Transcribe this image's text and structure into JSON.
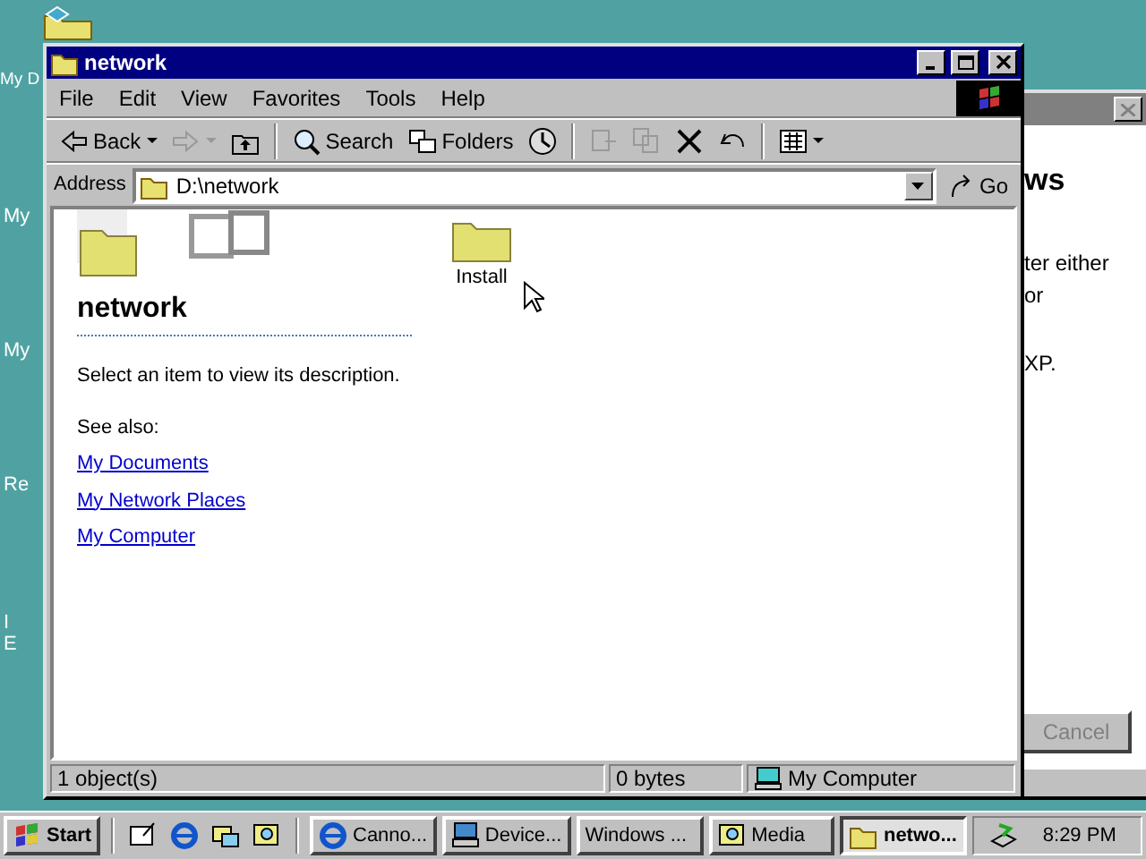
{
  "desktop_icons": [
    {
      "label": "My D"
    },
    {
      "label": "My"
    },
    {
      "label": "My"
    },
    {
      "label": "Re"
    },
    {
      "label": "I"
    },
    {
      "label": "E"
    }
  ],
  "background_window": {
    "heading": "ws",
    "lines": [
      "ter either",
      "or",
      "XP."
    ],
    "cancel_button": {
      "label": "Cancel",
      "disabled": true
    }
  },
  "window": {
    "title": "network"
  },
  "menu": [
    "File",
    "Edit",
    "View",
    "Favorites",
    "Tools",
    "Help"
  ],
  "toolbar": [
    {
      "kind": "button",
      "label": "Back",
      "dropdown": true,
      "disabled": false
    },
    {
      "kind": "button",
      "dropdown": true,
      "disabled": true
    },
    {
      "kind": "button",
      "disabled": false
    },
    {
      "kind": "separator"
    },
    {
      "kind": "button",
      "label": "Search",
      "disabled": false
    },
    {
      "kind": "button",
      "label": "Folders",
      "disabled": false
    },
    {
      "kind": "button",
      "disabled": false
    },
    {
      "kind": "separator"
    },
    {
      "kind": "button",
      "disabled": true
    },
    {
      "kind": "button",
      "disabled": true
    },
    {
      "kind": "button",
      "disabled": false
    },
    {
      "kind": "button",
      "disabled": false
    },
    {
      "kind": "separator"
    },
    {
      "kind": "button",
      "dropdown": true,
      "disabled": false
    }
  ],
  "address": {
    "label": "Address",
    "value": "D:\\network",
    "go": "Go"
  },
  "webview": {
    "folder_title": "network",
    "description": "Select an item to view its description.",
    "see_also": "See also:",
    "links": [
      "My Documents",
      "My Network Places",
      "My Computer"
    ]
  },
  "files": [
    {
      "name": "Install",
      "selected": false
    }
  ],
  "status_bar": [
    "1 object(s)",
    "0 bytes",
    "My Computer"
  ],
  "taskbar": {
    "start": "Start",
    "tasks": [
      {
        "label": "Canno...",
        "selected": false
      },
      {
        "label": "Device...",
        "selected": false
      },
      {
        "label": "Windows ...",
        "selected": false
      },
      {
        "label": "Media",
        "selected": false
      },
      {
        "label": "netwo...",
        "selected": true
      }
    ],
    "clock": "8:29 PM"
  }
}
